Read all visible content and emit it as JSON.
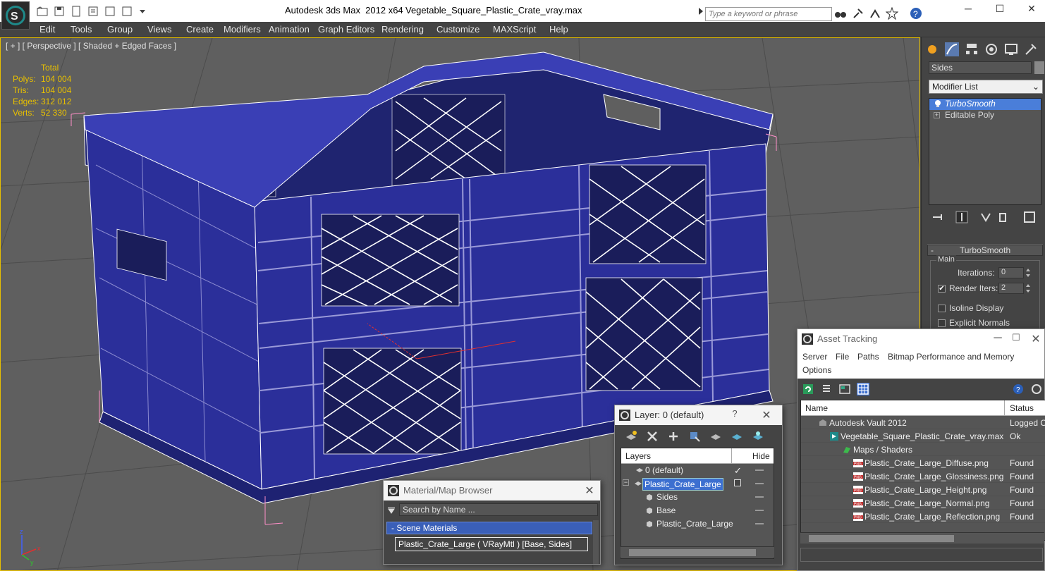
{
  "titlebar": {
    "app_title": "Autodesk 3ds Max  2012 x64",
    "file_name": "Vegetable_Square_Plastic_Crate_vray.max",
    "search_placeholder": "Type a keyword or phrase",
    "minimize": "─",
    "maximize": "☐",
    "close": "✕"
  },
  "menu": [
    "Edit",
    "Tools",
    "Group",
    "Views",
    "Create",
    "Modifiers",
    "Animation",
    "Graph Editors",
    "Rendering",
    "Customize",
    "MAXScript",
    "Help"
  ],
  "viewport": {
    "label": "[ + ] [ Perspective ] [ Shaded + Edged Faces ]",
    "stats_header": "Total",
    "stats": [
      {
        "key": "Polys:",
        "value": "104 004"
      },
      {
        "key": "Tris:",
        "value": "104 004"
      },
      {
        "key": "Edges:",
        "value": "312 012"
      },
      {
        "key": "Verts:",
        "value": "52 330"
      }
    ],
    "axis_labels": {
      "z": "z",
      "x": "x",
      "y": "y"
    },
    "colors": {
      "crate": "#2b2f9a",
      "crate_dark": "#1e2272",
      "wire": "#ffffff",
      "grid": "#474747",
      "bg": "#5f5f5f",
      "stats": "#e8c000"
    }
  },
  "command_panel": {
    "object_name": "Sides",
    "modifier_list": "Modifier List",
    "stack": [
      {
        "label": "TurboSmooth",
        "selected": true
      },
      {
        "label": "Editable Poly",
        "selected": false
      }
    ],
    "rollout_title": "TurboSmooth",
    "group_main": "Main",
    "iterations_label": "Iterations:",
    "iterations_value": "0",
    "render_iters_label": "Render Iters:",
    "render_iters_value": "2",
    "render_iters_checked": "✔",
    "isoline_label": "Isoline Display",
    "explicit_normals_label": "Explicit Normals"
  },
  "asset_tracking": {
    "title": "Asset Tracking",
    "menu": [
      "Server",
      "File",
      "Paths",
      "Bitmap Performance and Memory",
      "Options"
    ],
    "col_name": "Name",
    "col_status": "Status",
    "rows": [
      {
        "name": "Autodesk Vault 2012",
        "status": "Logged O",
        "indent": 1,
        "icon": "vault-icon"
      },
      {
        "name": "Vegetable_Square_Plastic_Crate_vray.max",
        "status": "Ok",
        "indent": 2,
        "icon": "max-file-icon"
      },
      {
        "name": "Maps / Shaders",
        "status": "",
        "indent": 3,
        "icon": "maps-folder-icon"
      },
      {
        "name": "Plastic_Crate_Large_Diffuse.png",
        "status": "Found",
        "indent": 4,
        "icon": "png-icon"
      },
      {
        "name": "Plastic_Crate_Large_Glossiness.png",
        "status": "Found",
        "indent": 4,
        "icon": "png-icon"
      },
      {
        "name": "Plastic_Crate_Large_Height.png",
        "status": "Found",
        "indent": 4,
        "icon": "png-icon"
      },
      {
        "name": "Plastic_Crate_Large_Normal.png",
        "status": "Found",
        "indent": 4,
        "icon": "png-icon"
      },
      {
        "name": "Plastic_Crate_Large_Reflection.png",
        "status": "Found",
        "indent": 4,
        "icon": "png-icon"
      }
    ],
    "png_badge": "PNG"
  },
  "layer_dialog": {
    "title": "Layer: 0 (default)",
    "help": "?",
    "col_layers": "Layers",
    "col_hide": "Hide",
    "rows": [
      {
        "name": "0 (default)",
        "indent": 0,
        "current": "✓"
      },
      {
        "name": "Plastic_Crate_Large",
        "indent": 0,
        "selected": true
      },
      {
        "name": "Sides",
        "indent": 1
      },
      {
        "name": "Base",
        "indent": 1
      },
      {
        "name": "Plastic_Crate_Large",
        "indent": 1
      }
    ]
  },
  "material_browser": {
    "title": "Material/Map Browser",
    "search_placeholder": "Search by Name ...",
    "group": "- Scene Materials",
    "item": "Plastic_Crate_Large  ( VRayMtl )  [Base, Sides]"
  }
}
